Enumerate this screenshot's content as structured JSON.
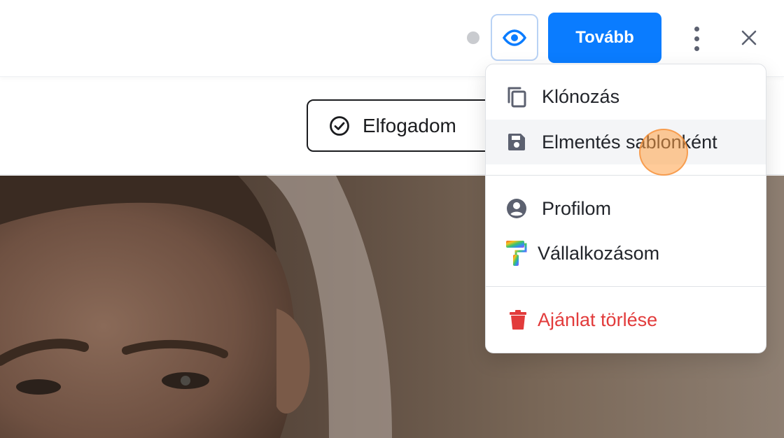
{
  "header": {
    "next_label": "Tovább",
    "status_indicator": "idle-dot",
    "preview_icon": "eye-icon",
    "more_icon": "more-vertical-icon",
    "close_icon": "close-icon"
  },
  "action_bar": {
    "accept_label": "Elfogadom",
    "accept_icon": "check-circle-icon"
  },
  "menu": {
    "items": [
      {
        "label": "Klónozás",
        "icon": "copy-icon"
      },
      {
        "label": "Elmentés sablonként",
        "icon": "save-icon"
      },
      {
        "label": "Profilom",
        "icon": "user-circle-icon"
      },
      {
        "label": "Vállalkozásom",
        "icon": "paint-roller-icon"
      },
      {
        "label": "Ajánlat törlése",
        "icon": "trash-icon"
      }
    ]
  },
  "colors": {
    "primary": "#0a7cff",
    "danger": "#e23b3b",
    "icon": "#5c6170",
    "text": "#22252b"
  }
}
